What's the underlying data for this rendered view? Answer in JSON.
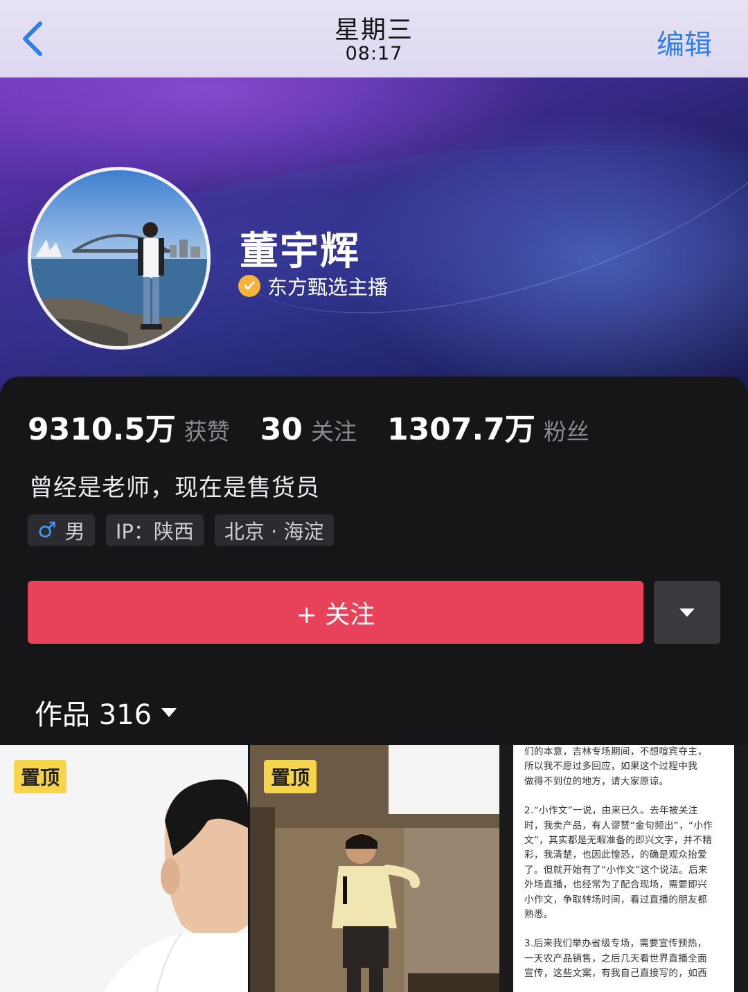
{
  "nav": {
    "title": "星期三",
    "subtitle": "08:17",
    "edit_label": "编辑"
  },
  "profile": {
    "name": "董宇辉",
    "verify_text": "东方甄选主播",
    "stats": [
      {
        "value": "9310.5万",
        "label": "获赞"
      },
      {
        "value": "30",
        "label": "关注"
      },
      {
        "value": "1307.7万",
        "label": "粉丝"
      }
    ],
    "bio": "曾经是老师，现在是售货员",
    "tags": [
      {
        "icon": "male-icon",
        "symbol": "♂",
        "text": "男"
      },
      {
        "text": "IP：陕西"
      },
      {
        "text": "北京 · 海淀"
      }
    ],
    "follow_label": "+ 关注"
  },
  "works": {
    "tab_label": "作品 316",
    "items": [
      {
        "badge": "置顶"
      },
      {
        "badge": "置顶"
      },
      {
        "doc_lines": [
          "们的本意，吉林专场期间，不想喧宾夺主，",
          "所以我不愿过多回应，如果这个过程中我",
          "做得不到位的地方，请大家原谅。",
          "",
          "2.“小作文”一说，由来已久。去年被关注",
          "时，我卖产品，有人谬赞“金句频出”，“小作",
          "文”，其实都是无暇准备的即兴文字，并不精",
          "彩，我清楚，也因此惶恐，的确是观众抬爱",
          "了。但就开始有了“小作文”这个说法。后来",
          "外场直播，也经常为了配合现场，需要即兴",
          "小作文，争取转场时间，看过直播的朋友都",
          "熟悉。",
          "",
          "3.后来我们举办省级专场，需要宣传预热，",
          "一天农产品销售，之后几天看世界直播全面",
          "宣传，这些文案，有我自己直接写的，如西"
        ]
      }
    ]
  },
  "colors": {
    "accent_blue": "#2f7fe8",
    "follow_red": "#e8425a",
    "verify_gold": "#f6b23a",
    "pin_yellow": "#f7d54a"
  }
}
